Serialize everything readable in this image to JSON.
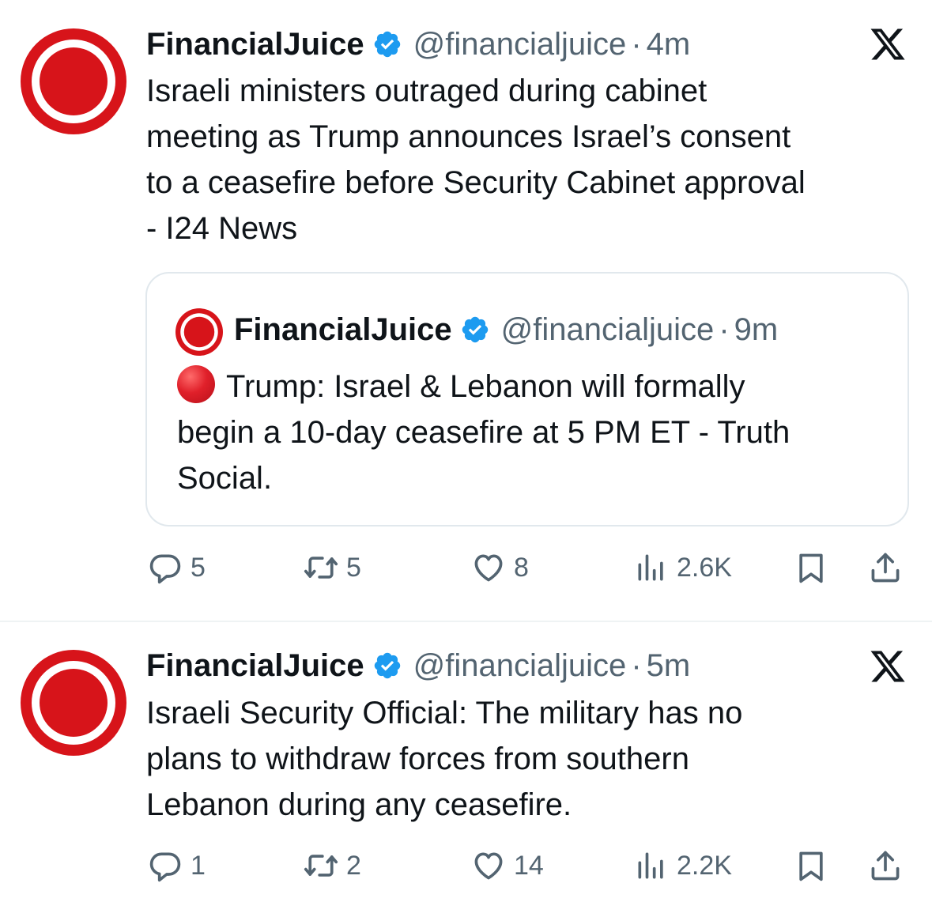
{
  "tweets": [
    {
      "author": {
        "name": "FinancialJuice",
        "handle": "@financialjuice",
        "verified": true
      },
      "separator": "·",
      "time": "4m",
      "text_lines": [
        "Israeli ministers outraged during cabinet",
        "meeting as Trump announces Israel’s consent",
        "to a ceasefire before Security Cabinet approval",
        "- I24 News"
      ],
      "quote": {
        "author": {
          "name": "FinancialJuice",
          "handle": "@financialjuice",
          "verified": true
        },
        "separator": "·",
        "time": "9m",
        "emoji": "red-circle",
        "text_lines": [
          "Trump: Israel & Lebanon will formally",
          "begin a 10-day ceasefire at 5 PM ET  - Truth",
          "Social."
        ]
      },
      "metrics": {
        "replies": "5",
        "reposts": "5",
        "likes": "8",
        "views": "2.6K"
      }
    },
    {
      "author": {
        "name": "FinancialJuice",
        "handle": "@financialjuice",
        "verified": true
      },
      "separator": "·",
      "time": "5m",
      "text_lines": [
        "Israeli Security Official: The military has no",
        "plans to withdraw forces from southern",
        "Lebanon during any ceasefire."
      ],
      "metrics": {
        "replies": "1",
        "reposts": "2",
        "likes": "14",
        "views": "2.2K"
      }
    }
  ],
  "icons": [
    "avatar-logo",
    "verified-badge-icon",
    "x-logo-icon",
    "reply-icon",
    "repost-icon",
    "like-icon",
    "views-icon",
    "bookmark-icon",
    "share-icon"
  ],
  "colors": {
    "brand_red": "#d7141a",
    "verified_blue": "#1d9bf0",
    "secondary_text": "#536471",
    "text": "#0f1419",
    "border": "#e1e8ed"
  }
}
